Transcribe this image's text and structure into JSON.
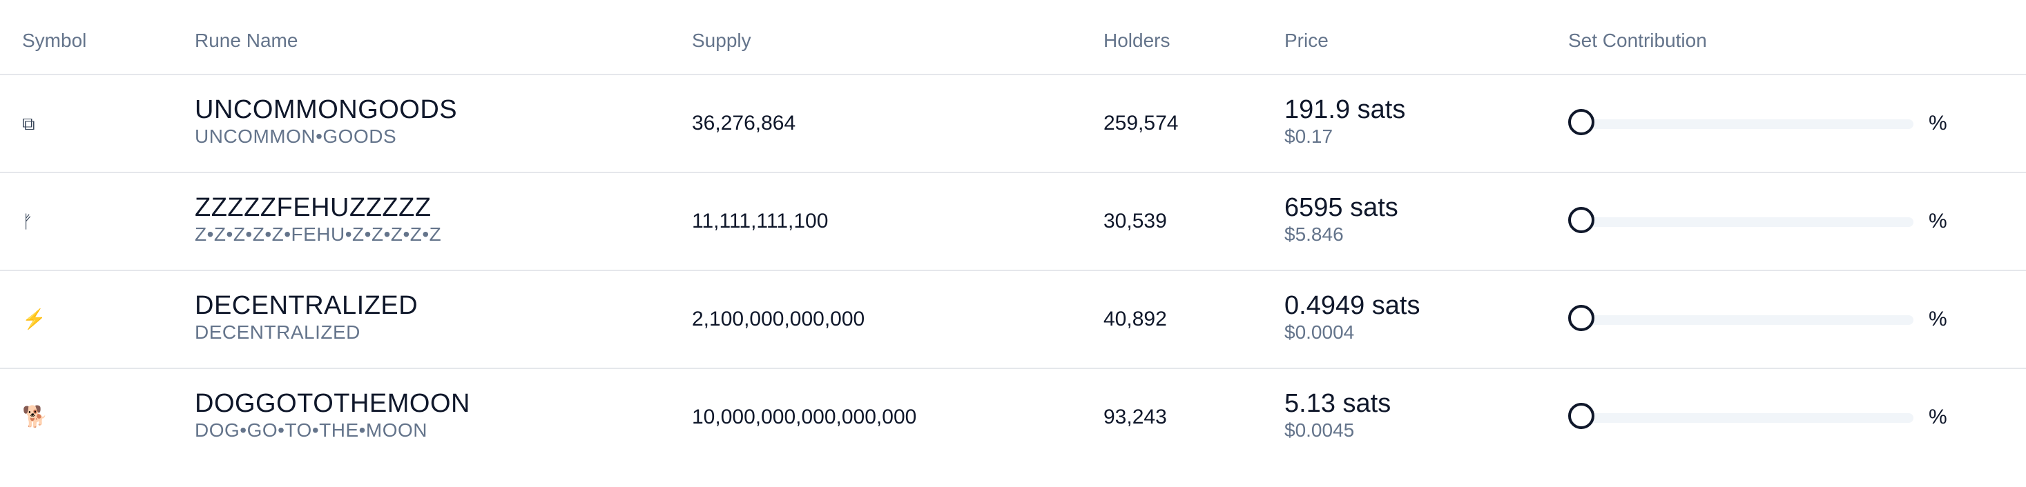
{
  "header": {
    "symbol": "Symbol",
    "rune_name": "Rune Name",
    "supply": "Supply",
    "holders": "Holders",
    "price": "Price",
    "set_contribution": "Set Contribution"
  },
  "rows": [
    {
      "symbol": "⧉",
      "symbol_icon": "copy-icon",
      "name": "UNCOMMONGOODS",
      "spaced_name": "UNCOMMON•GOODS",
      "supply": "36,276,864",
      "holders": "259,574",
      "price_sats": "191.9 sats",
      "price_usd": "$0.17",
      "contribution": 0,
      "pct_label": "%"
    },
    {
      "symbol": "ᚠ",
      "symbol_icon": "fehu-rune-icon",
      "name": "ZZZZZFEHUZZZZZ",
      "spaced_name": "Z•Z•Z•Z•Z•FEHU•Z•Z•Z•Z•Z",
      "supply": "11,111,111,100",
      "holders": "30,539",
      "price_sats": "6595 sats",
      "price_usd": "$5.846",
      "contribution": 0,
      "pct_label": "%"
    },
    {
      "symbol": "⚡",
      "symbol_icon": "lightning-icon",
      "name": "DECENTRALIZED",
      "spaced_name": "DECENTRALIZED",
      "supply": "2,100,000,000,000",
      "holders": "40,892",
      "price_sats": "0.4949 sats",
      "price_usd": "$0.0004",
      "contribution": 0,
      "pct_label": "%"
    },
    {
      "symbol": "🐕",
      "symbol_icon": "dog-icon",
      "name": "DOGGOTOTHEMOON",
      "spaced_name": "DOG•GO•TO•THE•MOON",
      "supply": "10,000,000,000,000,000",
      "holders": "93,243",
      "price_sats": "5.13 sats",
      "price_usd": "$0.0045",
      "contribution": 0,
      "pct_label": "%"
    }
  ],
  "colors": {
    "header_text": "#64748b",
    "body_text": "#0f172a",
    "divider": "#e5e7eb",
    "slider_track": "#f1f5f9",
    "lightning": "#f5b301"
  }
}
